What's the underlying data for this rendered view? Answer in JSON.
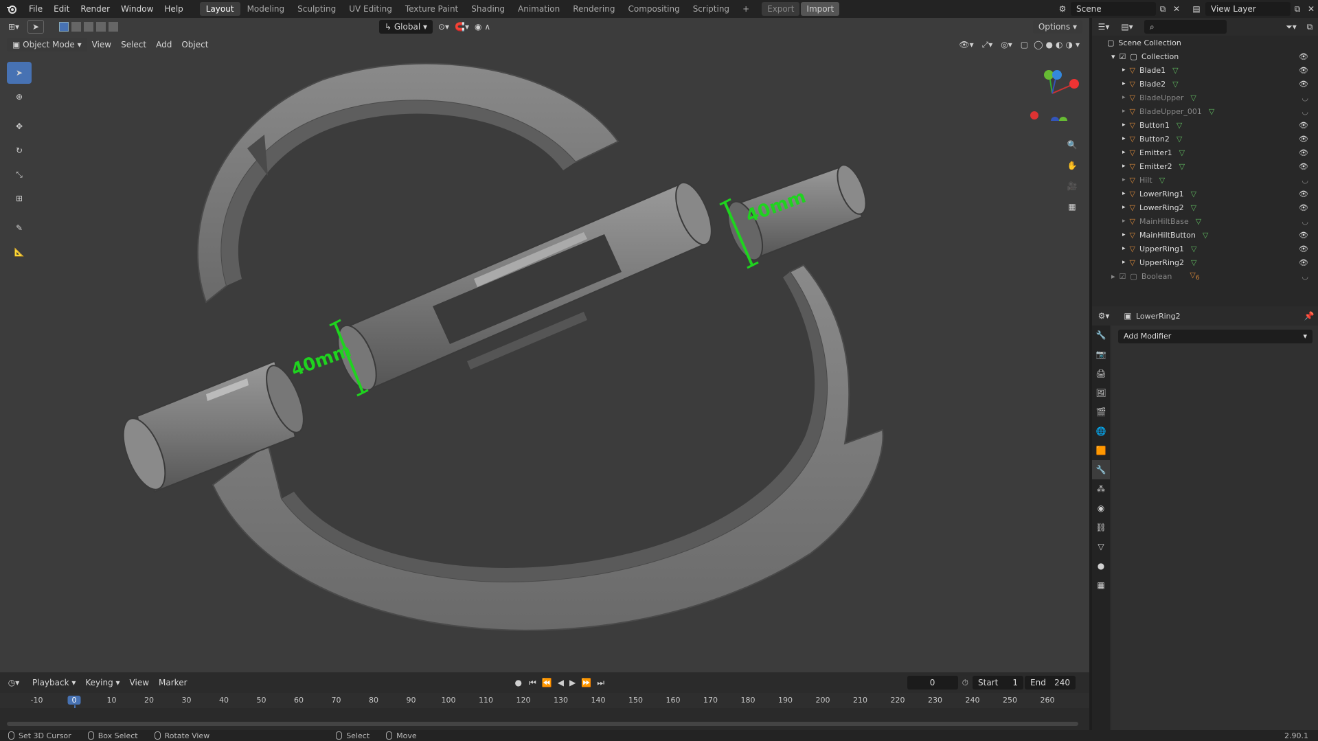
{
  "topbar": {
    "menus": [
      "File",
      "Edit",
      "Render",
      "Window",
      "Help"
    ],
    "workspaces": [
      "Layout",
      "Modeling",
      "Sculpting",
      "UV Editing",
      "Texture Paint",
      "Shading",
      "Animation",
      "Rendering",
      "Compositing",
      "Scripting"
    ],
    "active_workspace": "Layout",
    "export_label": "Export",
    "import_label": "Import",
    "scene_name": "Scene",
    "view_layer": "View Layer"
  },
  "viewport": {
    "mode": "Object Mode",
    "menus": [
      "View",
      "Select",
      "Add",
      "Object"
    ],
    "orientation": "Global",
    "options_label": "Options",
    "measure_labels": [
      "40mm",
      "40mm"
    ]
  },
  "outliner": {
    "root": "Scene Collection",
    "collection": "Collection",
    "items": [
      {
        "name": "Blade1",
        "visible": true
      },
      {
        "name": "Blade2",
        "visible": true
      },
      {
        "name": "BladeUpper",
        "visible": false
      },
      {
        "name": "BladeUpper_001",
        "visible": false
      },
      {
        "name": "Button1",
        "visible": true
      },
      {
        "name": "Button2",
        "visible": true
      },
      {
        "name": "Emitter1",
        "visible": true
      },
      {
        "name": "Emitter2",
        "visible": true
      },
      {
        "name": "Hilt",
        "visible": false
      },
      {
        "name": "LowerRing1",
        "visible": true
      },
      {
        "name": "LowerRing2",
        "visible": true
      },
      {
        "name": "MainHiltBase",
        "visible": false
      },
      {
        "name": "MainHiltButton",
        "visible": true
      },
      {
        "name": "UpperRing1",
        "visible": true
      },
      {
        "name": "UpperRing2",
        "visible": true
      }
    ],
    "boolean_collection": "Boolean",
    "boolean_count": "6"
  },
  "properties": {
    "object_name": "LowerRing2",
    "add_modifier_label": "Add Modifier"
  },
  "timeline": {
    "menus": [
      "Playback",
      "Keying",
      "View",
      "Marker"
    ],
    "current_frame": "0",
    "start_label": "Start",
    "start_value": "1",
    "end_label": "End",
    "end_value": "240",
    "ticks": [
      "-10",
      "0",
      "10",
      "20",
      "30",
      "40",
      "50",
      "60",
      "70",
      "80",
      "90",
      "100",
      "110",
      "120",
      "130",
      "140",
      "150",
      "160",
      "170",
      "180",
      "190",
      "200",
      "210",
      "220",
      "230",
      "240",
      "250",
      "260"
    ]
  },
  "statusbar": {
    "items": [
      "Set 3D Cursor",
      "Box Select",
      "Rotate View",
      "Select",
      "Move"
    ],
    "version": "2.90.1"
  },
  "colors": {
    "accent": "#4772b3",
    "measure": "#1fd31f",
    "active_tab": "#3d3d3d"
  }
}
